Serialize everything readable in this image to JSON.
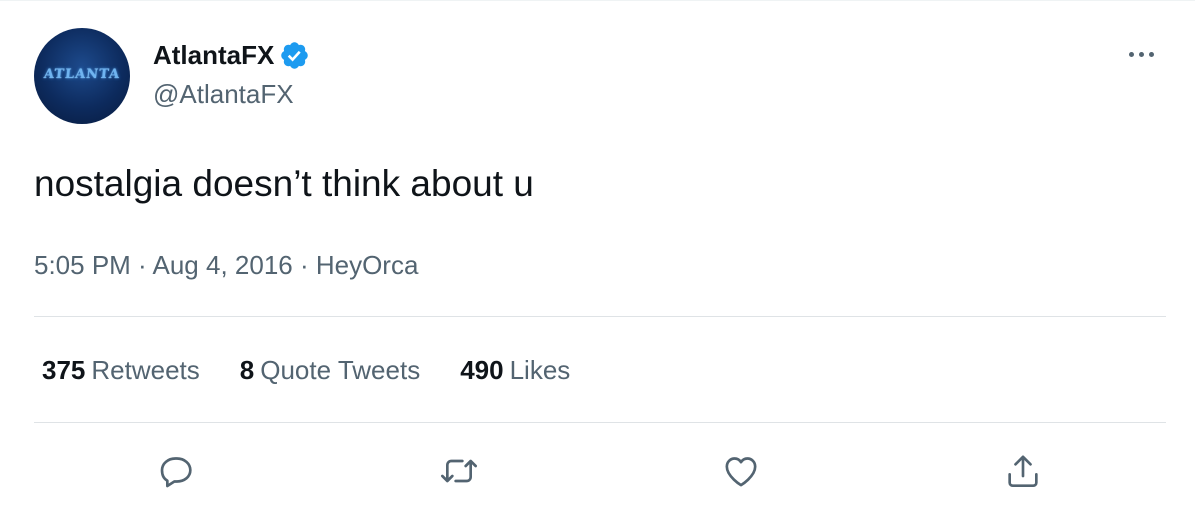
{
  "author": {
    "display_name": "AtlantaFX",
    "handle": "@AtlantaFX",
    "avatar_text": "ATLANTA",
    "verified": true
  },
  "tweet": {
    "text": "nostalgia doesn’t think about u",
    "time": "5:05 PM",
    "date": "Aug 4, 2016",
    "source": "HeyOrca",
    "separator": " · "
  },
  "stats": {
    "retweets_count": "375",
    "retweets_label": "Retweets",
    "quote_count": "8",
    "quote_label": "Quote Tweets",
    "likes_count": "490",
    "likes_label": "Likes"
  },
  "actions": {
    "reply_icon": "reply-icon",
    "retweet_icon": "retweet-icon",
    "like_icon": "heart-icon",
    "share_icon": "share-icon"
  },
  "colors": {
    "text_primary": "#0f1419",
    "text_secondary": "#536471",
    "verified_blue": "#1d9bf0",
    "divider": "#dfe3e6"
  }
}
